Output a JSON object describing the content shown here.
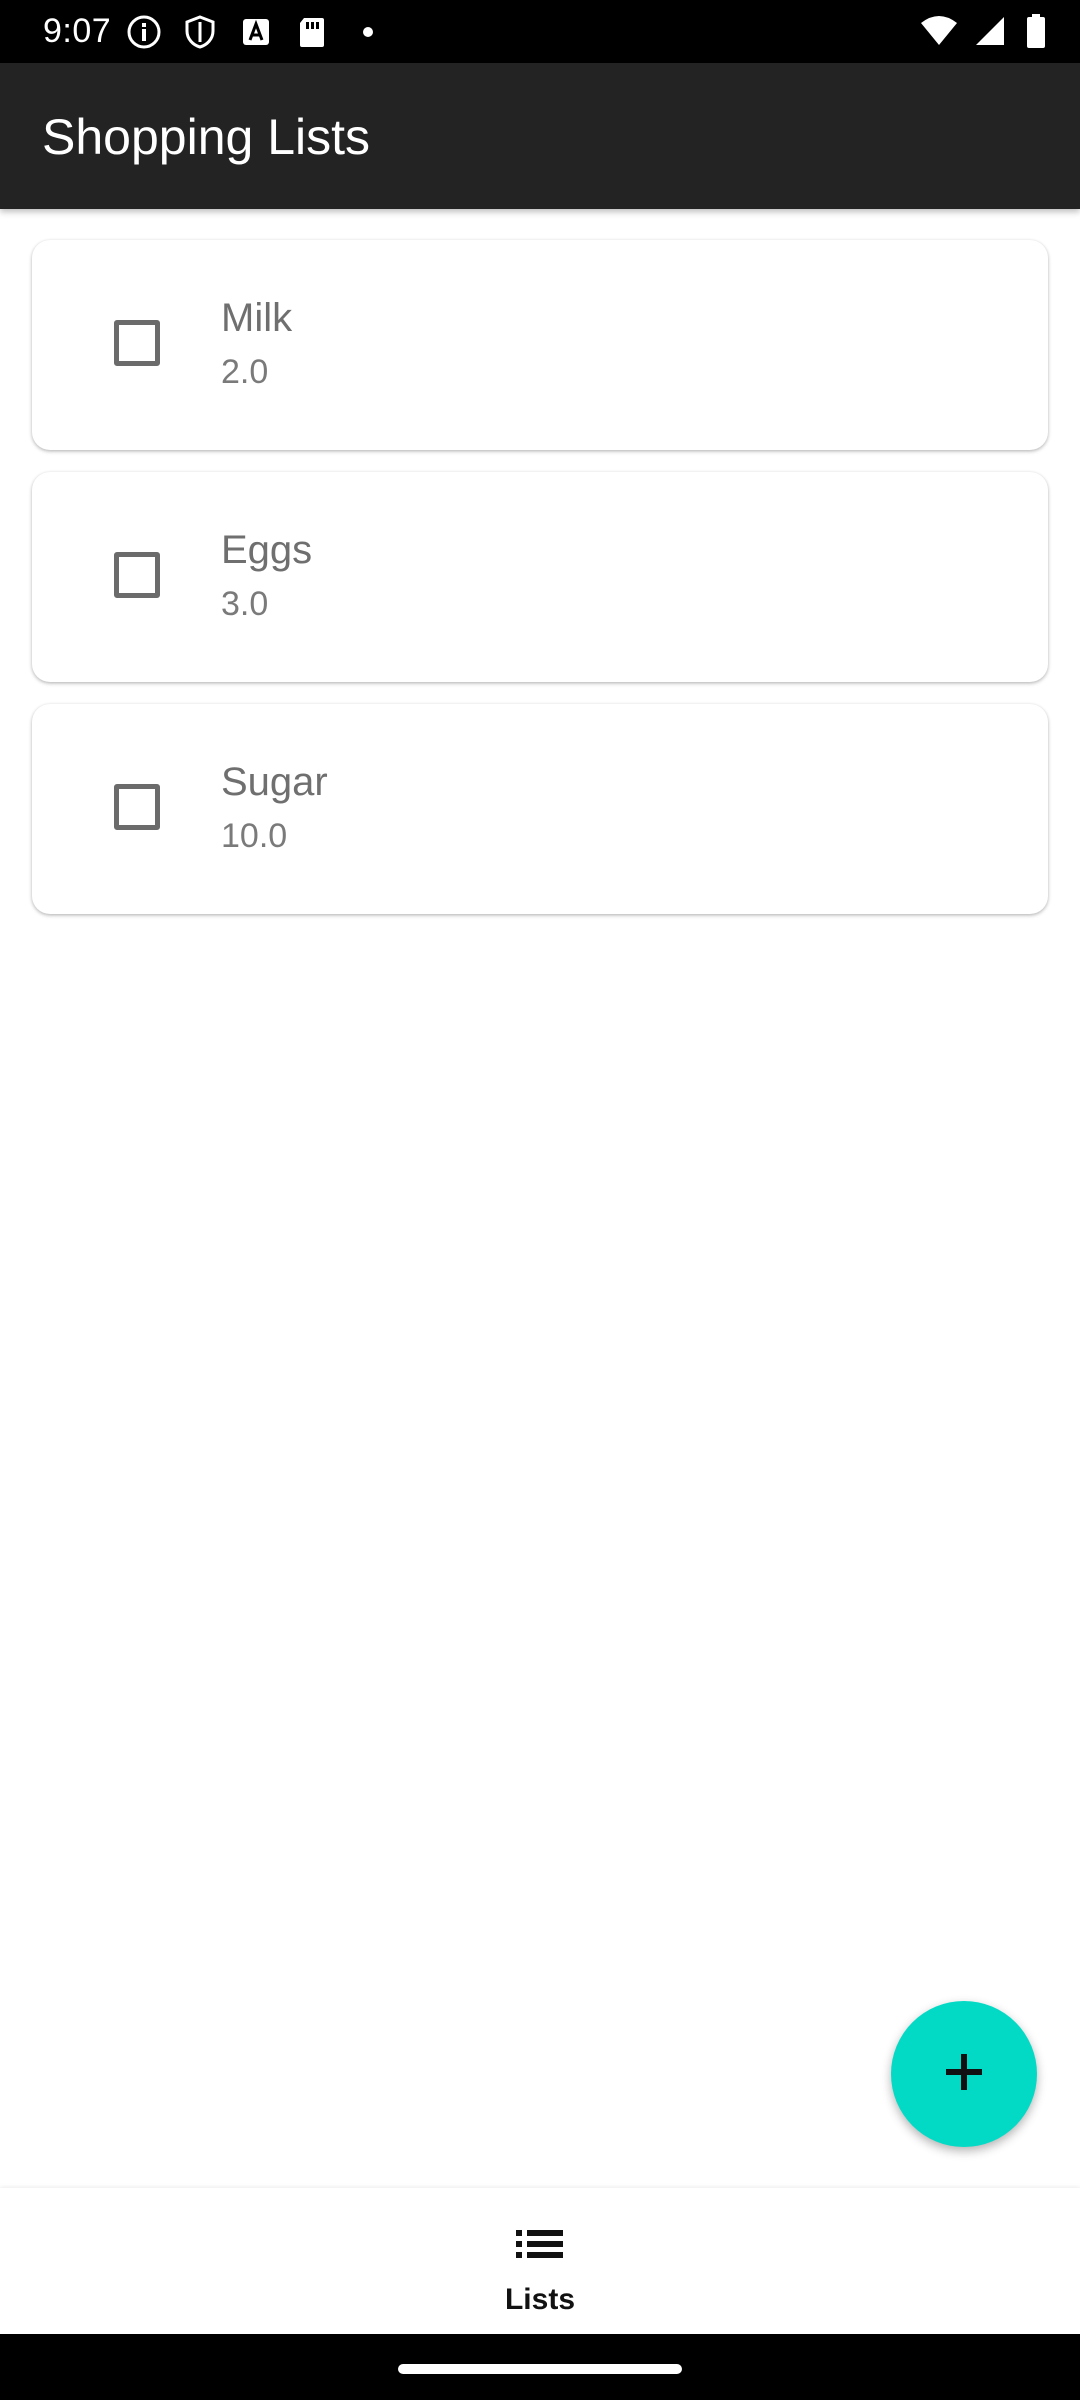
{
  "status_bar": {
    "time": "9:07",
    "left_icons": [
      "info-icon",
      "shield-icon",
      "text-a-icon",
      "sd-card-icon",
      "dot-icon"
    ],
    "right_icons": [
      "wifi-icon",
      "signal-icon",
      "battery-icon"
    ]
  },
  "app_bar": {
    "title": "Shopping Lists",
    "background": "#232323"
  },
  "items": [
    {
      "name": "Milk",
      "quantity": "2.0",
      "checked": false
    },
    {
      "name": "Eggs",
      "quantity": "3.0",
      "checked": false
    },
    {
      "name": "Sugar",
      "quantity": "10.0",
      "checked": false
    }
  ],
  "fab": {
    "icon": "plus-icon",
    "color": "#03dac6"
  },
  "bottom_nav": {
    "items": [
      {
        "label": "Lists",
        "icon": "list-icon"
      }
    ]
  }
}
